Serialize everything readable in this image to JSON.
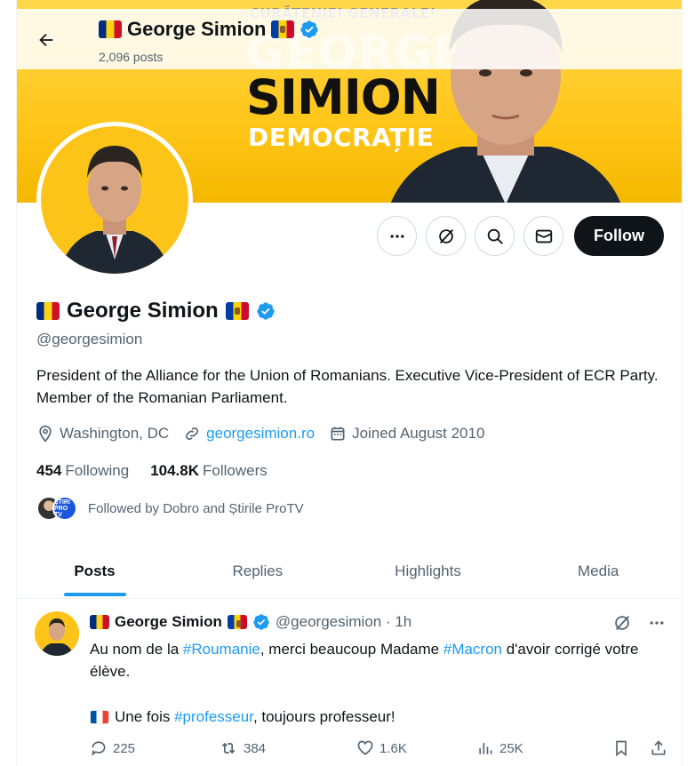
{
  "header": {
    "name": "George Simion",
    "posts_count": "2,096 posts"
  },
  "banner": {
    "top_text": "CURĂȚENIEI GENERALE!",
    "ghost_text": "GEORGE",
    "big_text": "SIMION",
    "sub_text": "DEMOCRAȚIE"
  },
  "actions": {
    "follow_label": "Follow"
  },
  "profile": {
    "name": "George Simion",
    "handle": "@georgesimion",
    "bio": "President of the Alliance for the Union of Romanians. Executive Vice-President of ECR Party. Member of the Romanian Parliament.",
    "location": "Washington, DC",
    "website": "georgesimion.ro",
    "joined": "Joined August 2010",
    "following_count": "454",
    "following_label": "Following",
    "followers_count": "104.8K",
    "followers_label": "Followers",
    "followed_by": "Followed by Dobro and Știrile ProTV",
    "follower_badge_text": "ȘTIRI PRO TV"
  },
  "tabs": [
    {
      "label": "Posts"
    },
    {
      "label": "Replies"
    },
    {
      "label": "Highlights"
    },
    {
      "label": "Media"
    }
  ],
  "tweet": {
    "name": "George Simion",
    "handle_time": "@georgesimion · 1h",
    "text_parts": {
      "p1": "Au nom de la ",
      "tag1": "#Roumanie",
      "p2": ", merci beaucoup Madame ",
      "tag2": "#Macron",
      "p3": " d'avoir corrigé votre élève."
    },
    "line2_parts": {
      "p1": "Une fois ",
      "tag": "#professeur",
      "p2": ", toujours professeur!"
    },
    "replies": "225",
    "reposts": "384",
    "likes": "1.6K",
    "views": "25K"
  },
  "icons": {
    "back": "arrow-left-icon",
    "more": "more-dots-icon",
    "grok": "grok-icon",
    "search": "search-icon",
    "message": "mail-icon",
    "verified": "verified-badge-icon"
  },
  "colors": {
    "accent": "#1d9bf0",
    "text": "#0f1419",
    "muted": "#536471",
    "banner_yellow": "#ffc61a"
  }
}
